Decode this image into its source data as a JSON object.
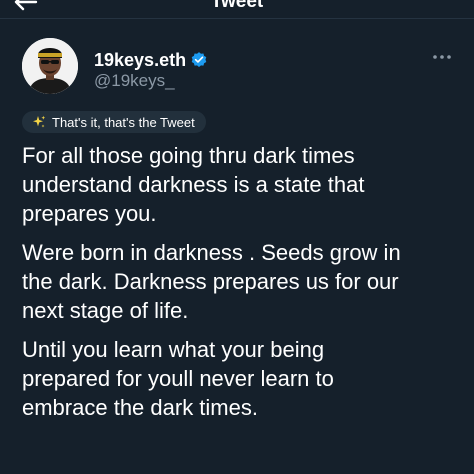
{
  "header": {
    "title": "Tweet",
    "back_icon": "arrow-left-icon"
  },
  "author": {
    "display_name": "19keys.eth",
    "handle": "@19keys_",
    "verified": true,
    "verified_icon": "verified-badge-icon",
    "verified_color": "#1d9bf0"
  },
  "more_icon": "more-horizontal-icon",
  "pill": {
    "icon": "sparkles-icon",
    "label": "That's it, that's the Tweet"
  },
  "tweet": {
    "paragraphs": [
      "For all those going thru dark times\nunderstand darkness is a state that\nprepares you.",
      "Were born in darkness . Seeds grow in\nthe dark. Darkness prepares us for our\nnext stage of life.",
      "Until you learn what your being\nprepared for youll never learn to\nembrace the dark times."
    ]
  },
  "colors": {
    "background": "#15202b",
    "text_primary": "#ffffff",
    "text_secondary": "#8b98a5",
    "pill_background": "#22303c"
  }
}
